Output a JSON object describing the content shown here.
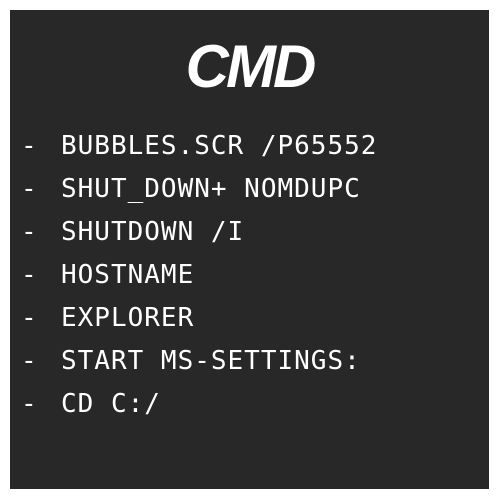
{
  "title": "CMD",
  "colors": {
    "background": "#282828",
    "text": "#ffffff"
  },
  "commands": [
    {
      "bullet": "-",
      "text": "BUBBLES.SCR /P65552"
    },
    {
      "bullet": "-",
      "text": "SHUT_DOWN+ NOMDUPC"
    },
    {
      "bullet": "-",
      "text": "SHUTDOWN /I"
    },
    {
      "bullet": "-",
      "text": "HOSTNAME"
    },
    {
      "bullet": "-",
      "text": "EXPLORER"
    },
    {
      "bullet": "-",
      "text": "START MS-SETTINGS:"
    },
    {
      "bullet": "-",
      "text": "CD C:/"
    }
  ]
}
